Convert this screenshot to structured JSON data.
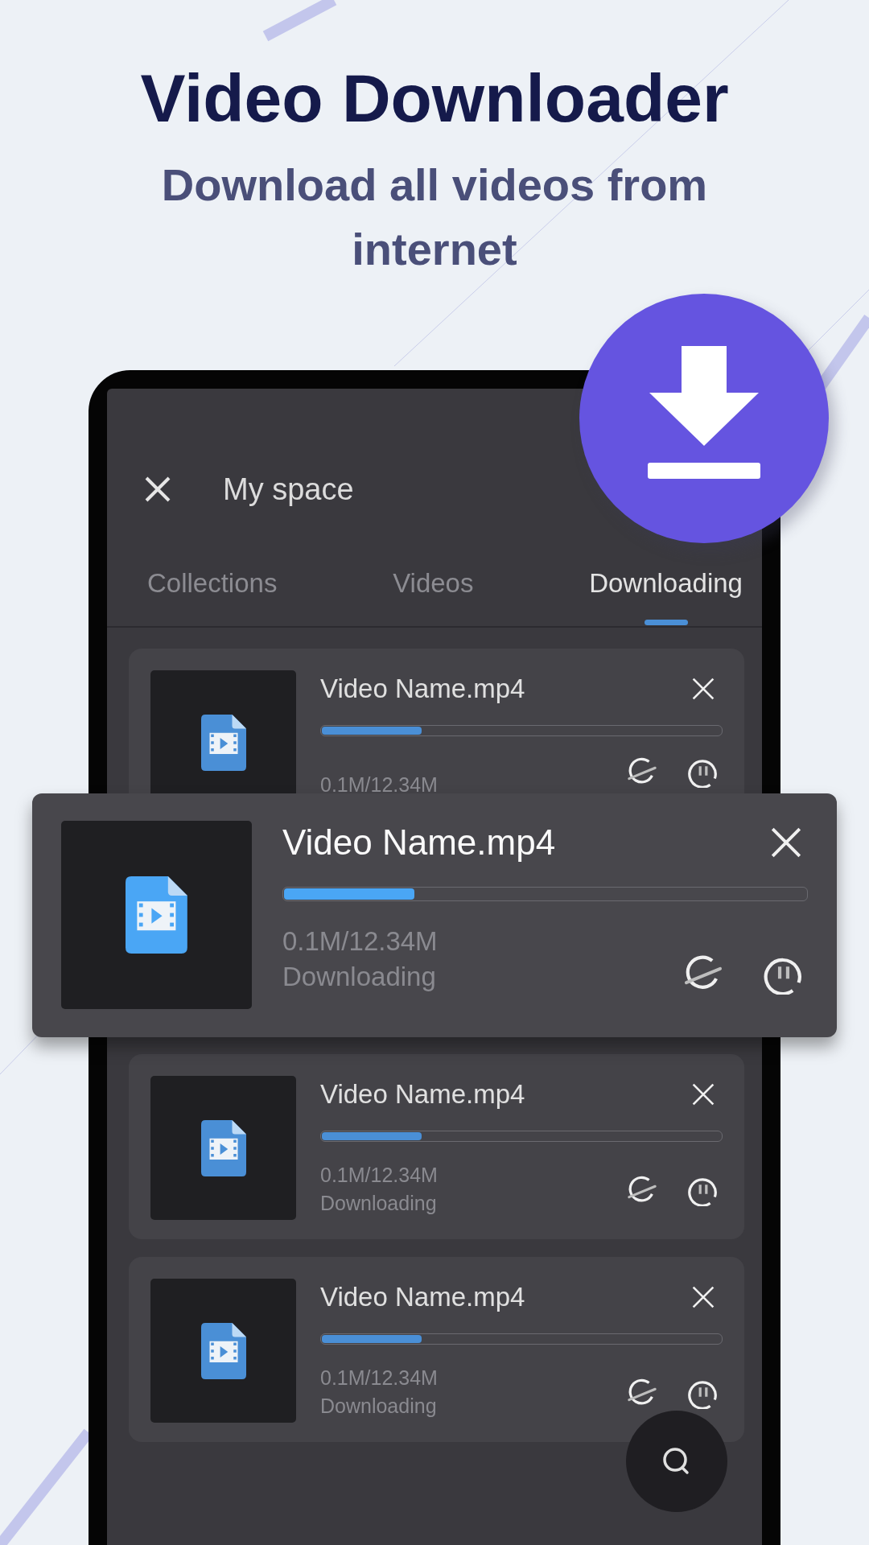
{
  "headline": {
    "title": "Video Downloader",
    "subtitle": "Download all videos from internet"
  },
  "screen": {
    "title": "My space",
    "tabs": [
      {
        "label": "Collections",
        "selected": false
      },
      {
        "label": "Videos",
        "selected": false
      },
      {
        "label": "Downloading",
        "selected": true
      }
    ],
    "downloads": [
      {
        "name": "Video Name.mp4",
        "level": 0.25,
        "size": "0.1M/12.34M"
      },
      {
        "name": "Video Name.mp4",
        "level": 0.25,
        "size": "0.1M/12.34M",
        "status": "Downloading"
      },
      {
        "name": "Video Name.mp4",
        "level": 0.25,
        "size": "0.1M/12.34M",
        "status": "Downloading"
      }
    ]
  },
  "highlight": {
    "name": "Video Name.mp4",
    "level": 0.25,
    "size": "0.1M/12.34M",
    "status": "Downloading"
  }
}
